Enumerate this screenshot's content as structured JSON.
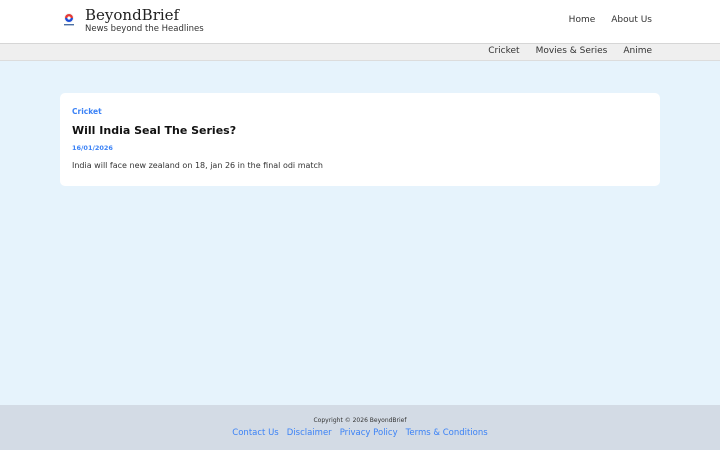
{
  "brand": {
    "name": "BeyondBrief",
    "tagline": "News beyond the Headlines"
  },
  "top_nav": {
    "items": [
      {
        "label": "Home"
      },
      {
        "label": "About Us"
      }
    ]
  },
  "category_nav": {
    "items": [
      {
        "label": "Cricket"
      },
      {
        "label": "Movies & Series"
      },
      {
        "label": "Anime"
      }
    ]
  },
  "article": {
    "category": "Cricket",
    "title": "Will India Seal The Series?",
    "date": "16/01/2026",
    "excerpt": "India will face new zealand on 18, jan 26 in the final odi match"
  },
  "footer": {
    "copyright": "Copyright © 2026 BeyondBrief",
    "links": [
      {
        "label": "Contact Us"
      },
      {
        "label": "Disclaimer"
      },
      {
        "label": "Privacy Policy"
      },
      {
        "label": "Terms & Conditions"
      }
    ]
  },
  "colors": {
    "page_background": "#e6f3fc",
    "accent": "#3b82f6",
    "footer_background": "#d3dbe5"
  }
}
